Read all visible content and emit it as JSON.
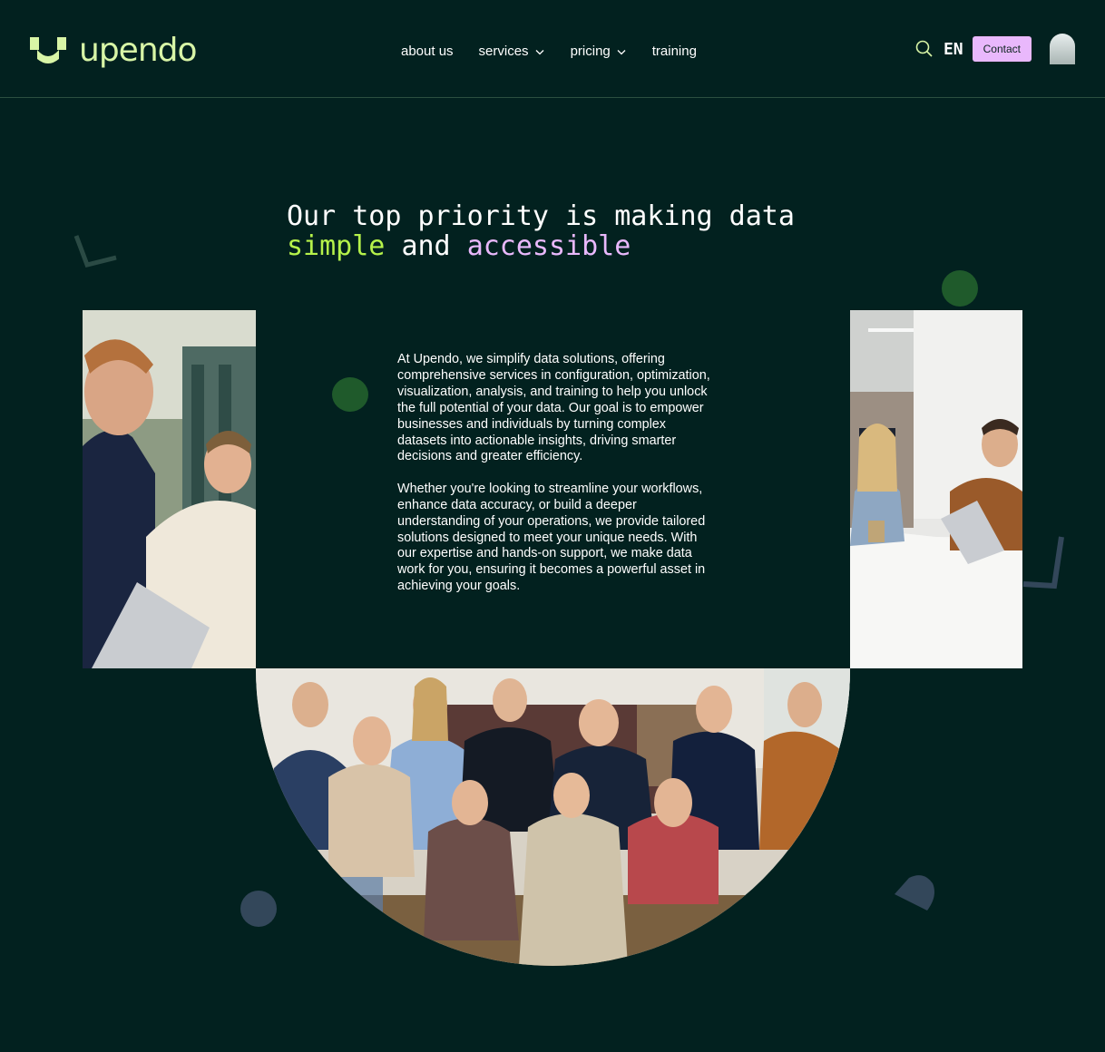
{
  "header": {
    "logo_text": "upendo",
    "nav": [
      {
        "label": "about us",
        "has_dropdown": false
      },
      {
        "label": "services",
        "has_dropdown": true
      },
      {
        "label": "pricing",
        "has_dropdown": true
      },
      {
        "label": "training",
        "has_dropdown": false
      }
    ],
    "language": "EN",
    "contact_label": "Contact"
  },
  "hero": {
    "line1": "Our top priority is making data",
    "word_simple": "simple",
    "word_and": "and",
    "word_accessible": "accessible"
  },
  "body": {
    "paragraph1": "At Upendo, we simplify data solutions, offering comprehensive services in configuration, optimization, visualization, analysis, and training to help you unlock the full potential of your data. Our goal is to empower businesses and individuals by turning complex datasets into actionable insights, driving smarter decisions and greater efficiency.",
    "paragraph2": "Whether you're looking to streamline your workflows, enhance data accuracy, or build a deeper understanding of your operations, we provide tailored solutions designed to meet your unique needs. With our expertise and hands-on support, we make data work for you, ensuring it becomes a powerful asset in achieving your goals."
  },
  "colors": {
    "background": "#02211f",
    "logo": "#d8f5a6",
    "accent_green": "#b5f24a",
    "accent_pink": "#e9b8fc",
    "deco_green": "#1f5a2b",
    "deco_slate": "#33475a"
  },
  "icons": [
    "logo-mark-icon",
    "chevron-down-icon",
    "search-icon"
  ]
}
